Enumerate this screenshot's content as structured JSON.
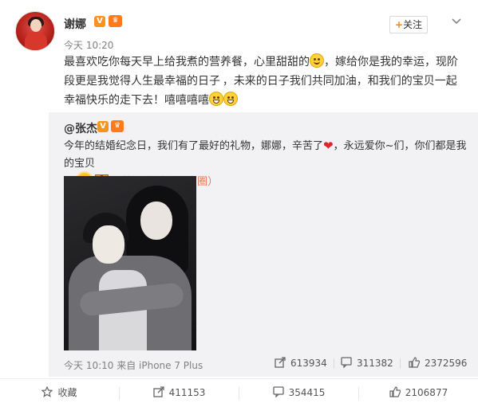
{
  "post": {
    "author": "谢娜",
    "verified_badge": "V",
    "time": "今天 10:20",
    "follow_label": "+关注",
    "follow_plus": "+",
    "follow_text": "关注",
    "text_part1": "最喜欢吃你每天早上给我煮的营养餐，心里甜甜的",
    "text_part2": "，嫁给你是我的幸运，现阶段更是我觉得人生最幸福的日子 ，未来的日子我们共同加油，和我们的宝贝一起幸福快乐的走下去！嘻嘻嘻嘻"
  },
  "repost": {
    "author": "@张杰",
    "verified_badge": "V",
    "text_part1": "今年的结婚纪念日，我们有了最好的礼物，娜娜，辛苦了",
    "text_part2": "，永远爱你~们，你们都是我的宝贝",
    "location": "苏州·金鸡湖（商圈）",
    "footer_time": "今天 10:10 来自 iPhone 7 Plus",
    "reposts": "613934",
    "comments": "311382",
    "likes": "2372596"
  },
  "actions": {
    "favorite_label": "收藏",
    "repost_count": "411153",
    "comment_count": "354415",
    "like_count": "2106877"
  },
  "icons": [
    "chevron-down-icon",
    "share-icon",
    "comment-icon",
    "like-icon",
    "star-icon",
    "location-icon"
  ],
  "colors": {
    "accent_orange": "#ff8200",
    "location": "#eb7350",
    "repost_bg": "#f2f2f5",
    "muted_text": "#808080"
  }
}
